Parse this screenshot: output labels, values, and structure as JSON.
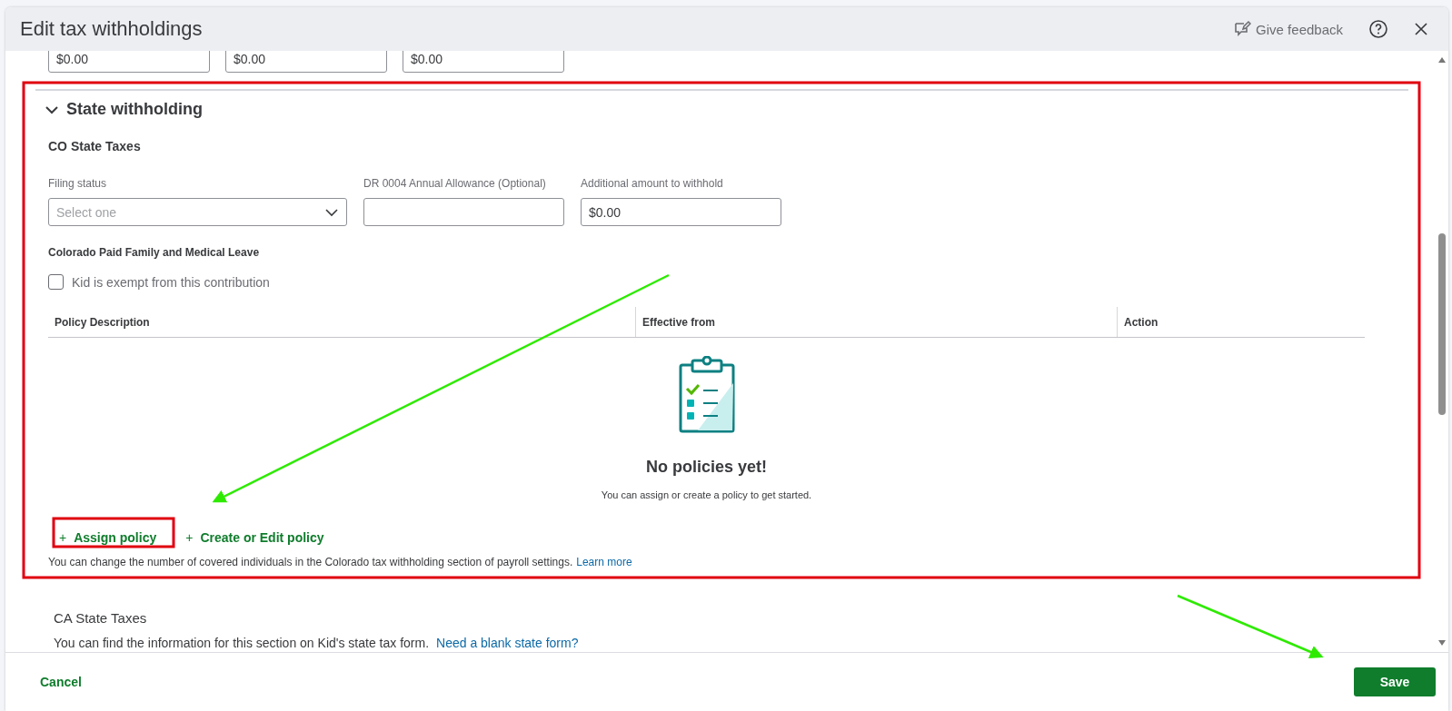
{
  "dialog": {
    "title": "Edit tax withholdings",
    "feedback": "Give feedback"
  },
  "top_fields": [
    {
      "value": "$0.00"
    },
    {
      "value": "$0.00"
    },
    {
      "value": "$0.00"
    }
  ],
  "section": {
    "title": "State withholding",
    "expanded": true,
    "state_title": "CO State Taxes",
    "fields": [
      {
        "kind": "select",
        "label": "Filing status",
        "placeholder": "Select one"
      },
      {
        "kind": "text",
        "label": "DR 0004 Annual Allowance (Optional)"
      },
      {
        "kind": "text",
        "label": "Additional amount to withhold",
        "value": "$0.00"
      }
    ],
    "leave_title": "Colorado Paid Family and Medical Leave",
    "exempt": {
      "label": "Kid is exempt from this contribution",
      "checked": false
    },
    "table": {
      "columns": [
        "Policy Description",
        "Effective from",
        "Action"
      ],
      "empty_title": "No policies yet!",
      "empty_text": "You can assign or create a policy to get started."
    },
    "actions": [
      {
        "icon": "+",
        "label": "Assign policy"
      },
      {
        "icon": "+",
        "label": "Create or Edit policy"
      }
    ],
    "note": {
      "text": "You can change the number of covered individuals in the Colorado tax withholding section of payroll settings.",
      "link": "Learn more"
    }
  },
  "ca": {
    "title": "CA State Taxes",
    "text": "You can find the information for this section on Kid's state tax form.",
    "link": "Need a blank state form?"
  },
  "footer": {
    "cancel": "Cancel",
    "save": "Save"
  }
}
